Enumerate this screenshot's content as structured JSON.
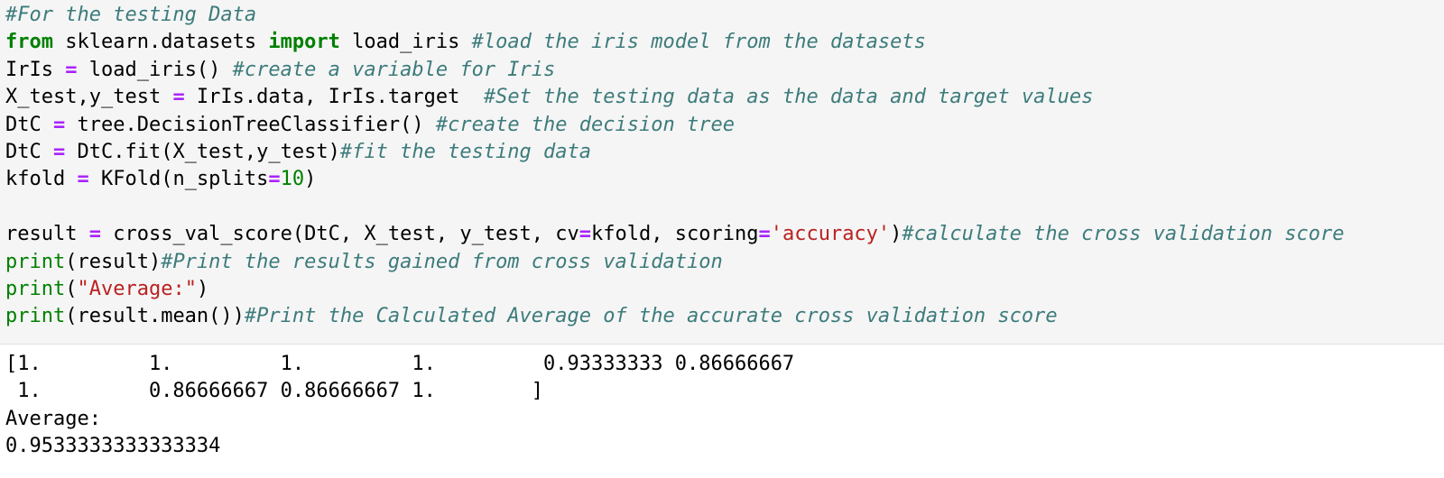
{
  "colors": {
    "code_background": "#f5f5f5",
    "output_background": "#ffffff",
    "comment": "#3d7b7b",
    "keyword": "#008000",
    "operator": "#aa22ff",
    "string": "#ba2121",
    "number": "#008000",
    "text": "#000000"
  },
  "code_cell": {
    "lines": [
      [
        {
          "t": "#For the testing Data",
          "c": "comment"
        }
      ],
      [
        {
          "t": "from",
          "c": "keyword"
        },
        {
          "t": " sklearn.datasets ",
          "c": "plain"
        },
        {
          "t": "import",
          "c": "keyword"
        },
        {
          "t": " load_iris ",
          "c": "plain"
        },
        {
          "t": "#load the iris model from the datasets",
          "c": "comment"
        }
      ],
      [
        {
          "t": "IrIs ",
          "c": "plain"
        },
        {
          "t": "=",
          "c": "operator"
        },
        {
          "t": " load_iris() ",
          "c": "plain"
        },
        {
          "t": "#create a variable for Iris",
          "c": "comment"
        }
      ],
      [
        {
          "t": "X_test,y_test ",
          "c": "plain"
        },
        {
          "t": "=",
          "c": "operator"
        },
        {
          "t": " IrIs.data, IrIs.target  ",
          "c": "plain"
        },
        {
          "t": "#Set the testing data as the data and target values",
          "c": "comment"
        }
      ],
      [
        {
          "t": "DtC ",
          "c": "plain"
        },
        {
          "t": "=",
          "c": "operator"
        },
        {
          "t": " tree.DecisionTreeClassifier() ",
          "c": "plain"
        },
        {
          "t": "#create the decision tree",
          "c": "comment"
        }
      ],
      [
        {
          "t": "DtC ",
          "c": "plain"
        },
        {
          "t": "=",
          "c": "operator"
        },
        {
          "t": " DtC.fit(X_test,y_test)",
          "c": "plain"
        },
        {
          "t": "#fit the testing data",
          "c": "comment"
        }
      ],
      [
        {
          "t": "kfold ",
          "c": "plain"
        },
        {
          "t": "=",
          "c": "operator"
        },
        {
          "t": " KFold(n_splits",
          "c": "plain"
        },
        {
          "t": "=",
          "c": "operator"
        },
        {
          "t": "10",
          "c": "number"
        },
        {
          "t": ")",
          "c": "plain"
        }
      ],
      [],
      [
        {
          "t": "result ",
          "c": "plain"
        },
        {
          "t": "=",
          "c": "operator"
        },
        {
          "t": " cross_val_score(DtC, X_test, y_test, cv",
          "c": "plain"
        },
        {
          "t": "=",
          "c": "operator"
        },
        {
          "t": "kfold, scoring",
          "c": "plain"
        },
        {
          "t": "=",
          "c": "operator"
        },
        {
          "t": "'accuracy'",
          "c": "string"
        },
        {
          "t": ")",
          "c": "plain"
        },
        {
          "t": "#calculate the cross validation score",
          "c": "comment"
        }
      ],
      [
        {
          "t": "print",
          "c": "builtin"
        },
        {
          "t": "(result)",
          "c": "plain"
        },
        {
          "t": "#Print the results gained from cross validation",
          "c": "comment"
        }
      ],
      [
        {
          "t": "print",
          "c": "builtin"
        },
        {
          "t": "(",
          "c": "plain"
        },
        {
          "t": "\"Average:\"",
          "c": "string"
        },
        {
          "t": ")",
          "c": "plain"
        }
      ],
      [
        {
          "t": "print",
          "c": "builtin"
        },
        {
          "t": "(result.mean())",
          "c": "plain"
        },
        {
          "t": "#Print the Calculated Average of the accurate cross validation score",
          "c": "comment"
        }
      ]
    ]
  },
  "output_cell": {
    "lines": [
      "[1.         1.         1.         1.         0.93333333 0.86666667",
      " 1.         0.86666667 0.86666667 1.        ]",
      "Average:",
      "0.9533333333333334"
    ]
  }
}
